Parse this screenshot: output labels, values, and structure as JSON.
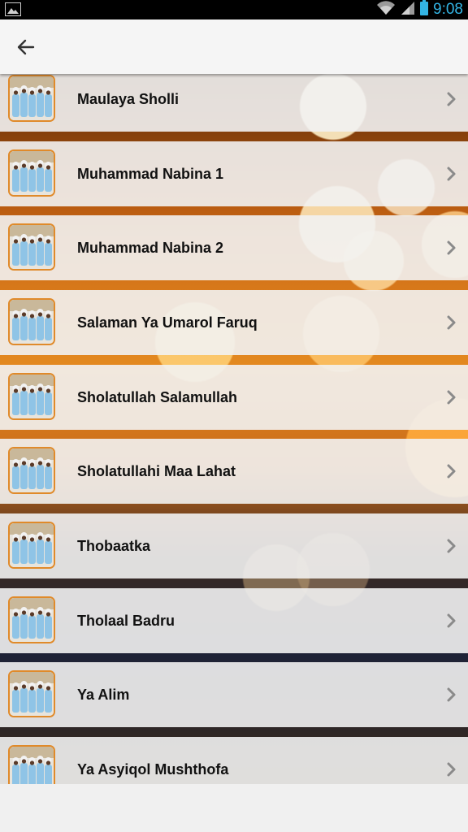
{
  "status_bar": {
    "time": "9:08",
    "icons": [
      "image-icon",
      "wifi-icon",
      "signal-icon",
      "battery-icon"
    ]
  },
  "app_bar": {
    "back_icon": "arrow-left-icon",
    "title": ""
  },
  "list": {
    "items": [
      {
        "label": "Maulaya Sholli"
      },
      {
        "label": "Muhammad Nabina 1"
      },
      {
        "label": "Muhammad Nabina 2"
      },
      {
        "label": "Salaman Ya Umarol Faruq"
      },
      {
        "label": "Sholatullah Salamullah"
      },
      {
        "label": "Sholatullahi Maa Lahat"
      },
      {
        "label": "Thobaatka"
      },
      {
        "label": "Tholaal Badru"
      },
      {
        "label": "Ya Alim"
      },
      {
        "label": "Ya Asyiqol Mushthofa"
      }
    ],
    "thumbnail_icon": "group-photo-thumbnail",
    "row_chevron_icon": "chevron-right-icon"
  },
  "colors": {
    "status_bar_bg": "#000000",
    "status_text": "#33b5e5",
    "app_bar_bg": "#f5f5f5",
    "thumb_border": "#e08a2a"
  }
}
